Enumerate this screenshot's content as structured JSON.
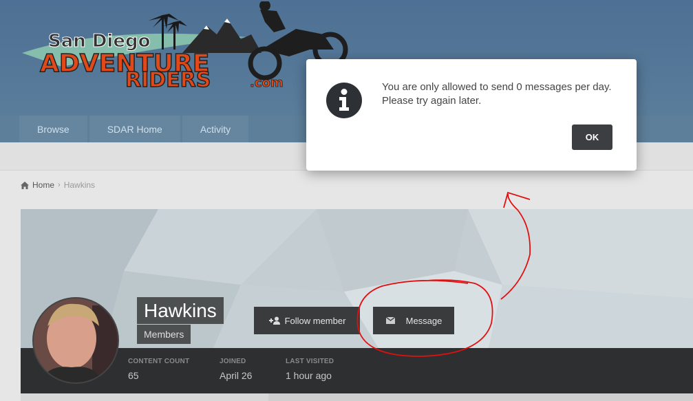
{
  "logo": {
    "line1": "San Diego",
    "line2": "ADVENTURE",
    "line3": "RIDERS",
    "suffix": ".com"
  },
  "nav": {
    "items": [
      {
        "label": "Browse"
      },
      {
        "label": "SDAR Home"
      },
      {
        "label": "Activity"
      }
    ]
  },
  "breadcrumb": {
    "home": "Home",
    "current": "Hawkins"
  },
  "profile": {
    "name": "Hawkins",
    "group": "Members",
    "follow_label": "Follow member",
    "message_label": "Message",
    "stats": [
      {
        "label": "CONTENT COUNT",
        "value": "65"
      },
      {
        "label": "JOINED",
        "value": "April 26"
      },
      {
        "label": "LAST VISITED",
        "value": "1 hour ago"
      }
    ]
  },
  "modal": {
    "message": "You are only allowed to send 0 messages per day. Please try again later.",
    "ok_label": "OK"
  },
  "colors": {
    "annotation": "#e01010",
    "header": "#5a7d9b",
    "button": "#3a3b3d"
  }
}
